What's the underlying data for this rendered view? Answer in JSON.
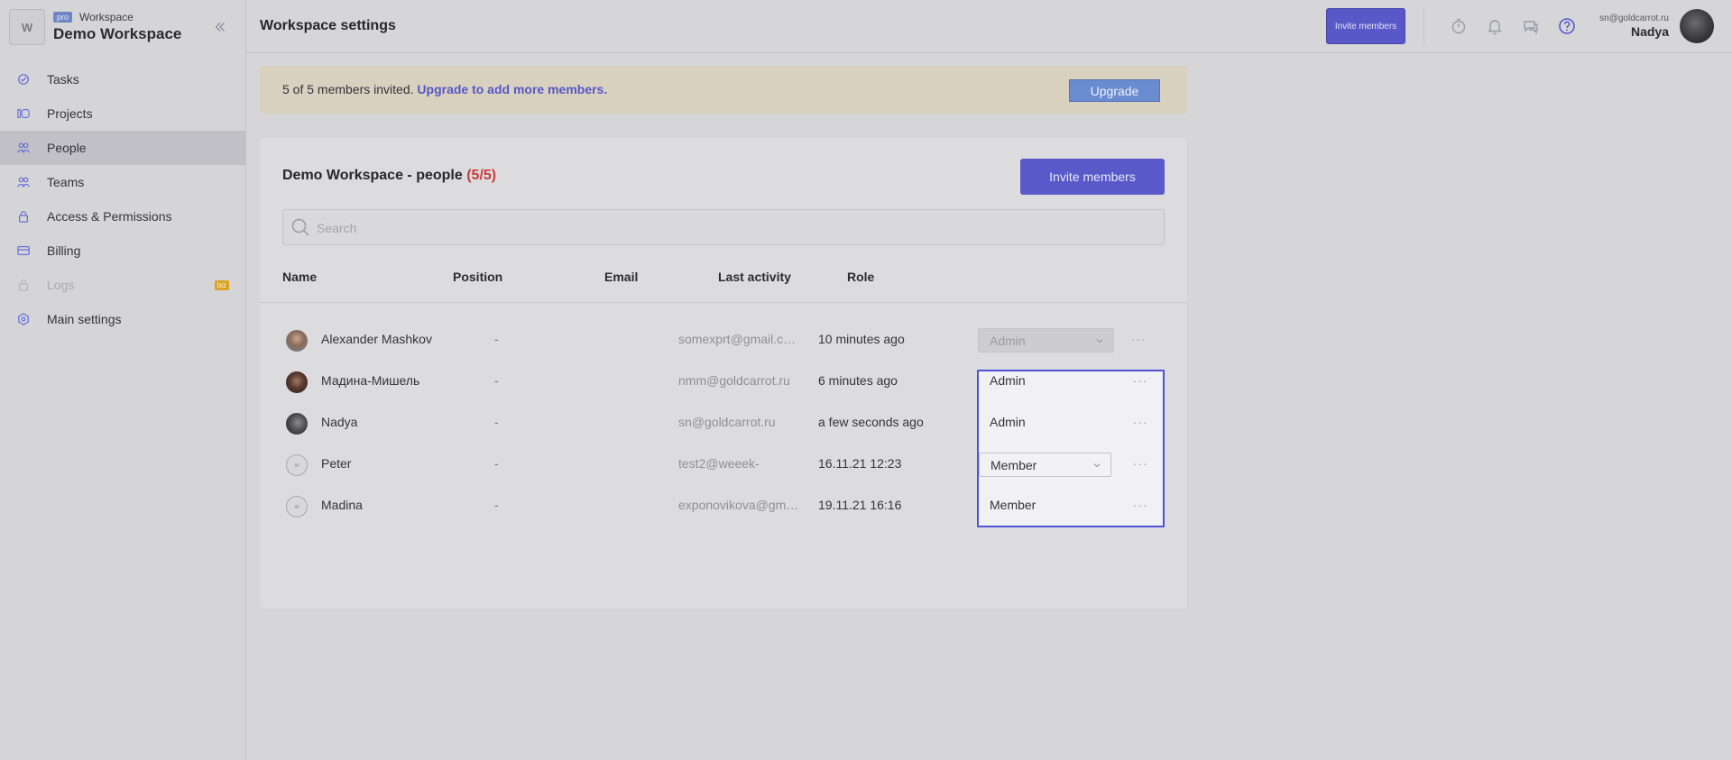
{
  "workspace": {
    "logo_letter": "W",
    "plan_badge": "pro",
    "kind": "Workspace",
    "name": "Demo Workspace"
  },
  "sidebar": {
    "items": [
      {
        "label": "Tasks",
        "icon": "check-circle-icon"
      },
      {
        "label": "Projects",
        "icon": "projects-icon"
      },
      {
        "label": "People",
        "icon": "people-icon",
        "active": true
      },
      {
        "label": "Teams",
        "icon": "teams-icon"
      },
      {
        "label": "Access & Permissions",
        "icon": "lock-icon"
      },
      {
        "label": "Billing",
        "icon": "credit-card-icon"
      },
      {
        "label": "Logs",
        "icon": "lock-icon",
        "disabled": true,
        "badge": "biz"
      },
      {
        "label": "Main settings",
        "icon": "gear-icon"
      }
    ]
  },
  "header": {
    "title": "Workspace settings",
    "invite_label": "Invite members",
    "user_email": "sn@goldcarrot.ru",
    "user_name": "Nadya"
  },
  "banner": {
    "text": "5 of 5 members invited.",
    "link": "Upgrade to add more members.",
    "button": "Upgrade"
  },
  "people": {
    "title": "Demo Workspace - people",
    "count": "(5/5)",
    "invite_label": "Invite members",
    "search_placeholder": "Search",
    "columns": [
      "Name",
      "Position",
      "Email",
      "Last activity",
      "Role"
    ],
    "rows": [
      {
        "name": "Alexander Mashkov",
        "position": "-",
        "email": "somexprt@gmail.com",
        "activity": "10 minutes ago",
        "role": "Admin"
      },
      {
        "name": "Мадина-Мишель",
        "position": "-",
        "email": "nmm@goldcarrot.ru",
        "activity": "6 minutes ago",
        "role": "Admin"
      },
      {
        "name": "Nadya",
        "position": "-",
        "email": "sn@goldcarrot.ru",
        "activity": "a few seconds ago",
        "role": "Admin"
      },
      {
        "name": "Peter",
        "position": "-",
        "email": "test2@weeek-",
        "activity": "16.11.21 12:23",
        "role": "Member"
      },
      {
        "name": "Madina",
        "position": "-",
        "email": "exponovikova@gmail.com",
        "activity": "19.11.21 16:16",
        "role": "Member"
      }
    ],
    "more_glyph": "···"
  },
  "colors": {
    "accent": "#5959c9",
    "focus_outline": "#4f52d6",
    "count_red": "#c83c3c"
  }
}
